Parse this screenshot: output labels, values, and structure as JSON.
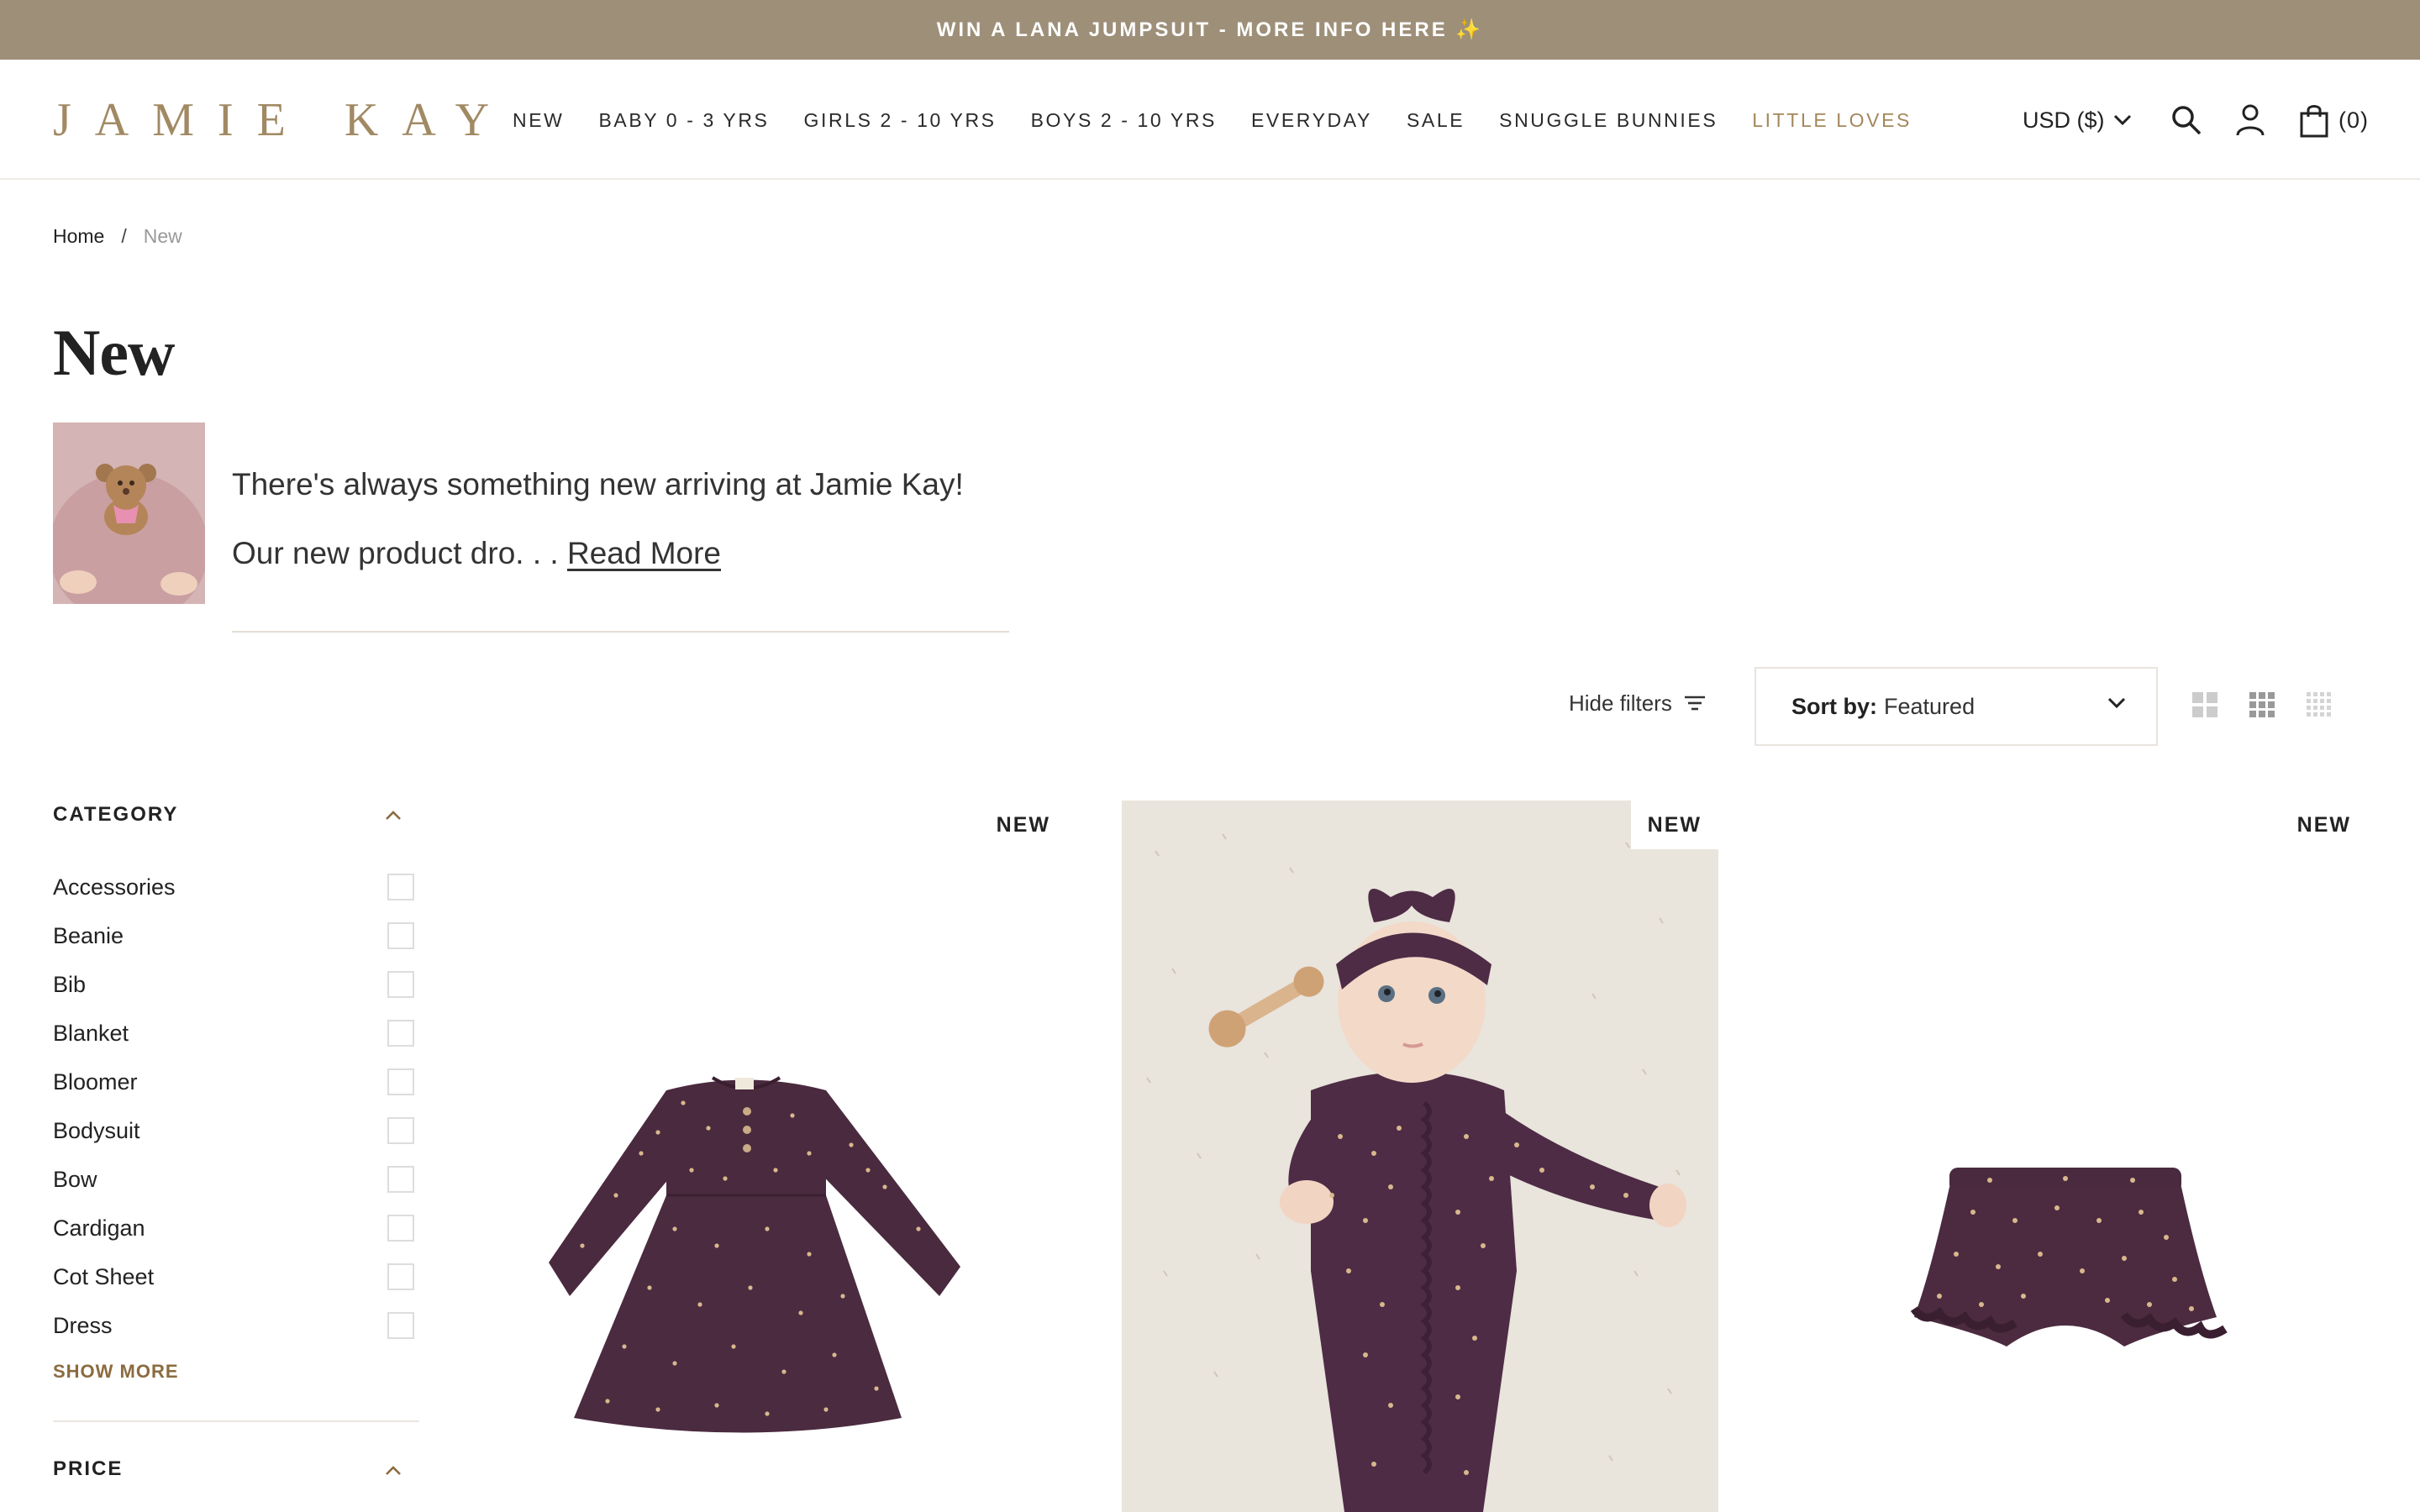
{
  "announcement": "WIN A LANA JUMPSUIT - MORE INFO HERE ✨",
  "logo": "JAMIE KAY",
  "nav": [
    "NEW",
    "BABY 0 - 3 YRS",
    "GIRLS 2 - 10 YRS",
    "BOYS 2 - 10 YRS",
    "EVERYDAY",
    "SALE",
    "SNUGGLE BUNNIES",
    "LITTLE LOVES"
  ],
  "header": {
    "currency": "USD ($)",
    "cart_count": "(0)",
    "icons": [
      "search-icon",
      "account-icon",
      "cart-icon"
    ]
  },
  "breadcrumb": {
    "home": "Home",
    "sep": "/",
    "current": "New"
  },
  "page_title": "New",
  "intro": {
    "line1": "There's always something new arriving at Jamie Kay!",
    "line2": "Our new product dro. . .",
    "read_more": "Read More"
  },
  "toolbar": {
    "hide_filters": "Hide filters",
    "sort_label": "Sort by:",
    "sort_value": "Featured"
  },
  "filters": {
    "category_heading": "CATEGORY",
    "categories": [
      "Accessories",
      "Beanie",
      "Bib",
      "Blanket",
      "Bloomer",
      "Bodysuit",
      "Bow",
      "Cardigan",
      "Cot Sheet",
      "Dress"
    ],
    "show_more": "SHOW MORE",
    "price_heading": "PRICE"
  },
  "products": [
    {
      "badge": "NEW",
      "image": "dress-image"
    },
    {
      "badge": "NEW",
      "image": "baby-onesie-image"
    },
    {
      "badge": "NEW",
      "image": "bloomer-image"
    }
  ],
  "colors": {
    "announce_bg": "#9e8f79",
    "brand_gold": "#a18963",
    "accent_nav": "#a4875c",
    "product_plum": "#4a2a3e"
  }
}
